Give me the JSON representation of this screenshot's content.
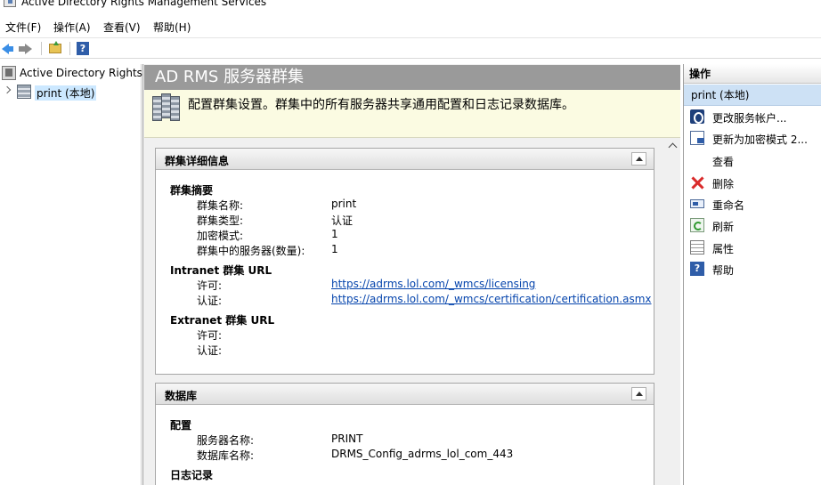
{
  "window": {
    "title": "Active Directory Rights Management Services"
  },
  "menu": [
    "文件(F)",
    "操作(A)",
    "查看(V)",
    "帮助(H)"
  ],
  "tree": {
    "root_label": "Active Directory Rights",
    "child_label": "print (本地)"
  },
  "center": {
    "title": "AD RMS 服务器群集",
    "banner_text": "配置群集设置。群集中的所有服务器共享通用配置和日志记录数据库。",
    "cluster_section": {
      "header": "群集详细信息",
      "summary": {
        "title": "群集摘要",
        "rows": [
          {
            "label": "群集名称:",
            "value": "print"
          },
          {
            "label": "群集类型:",
            "value": "认证"
          },
          {
            "label": "加密模式:",
            "value": "1"
          },
          {
            "label": "群集中的服务器(数量):",
            "value": "1"
          }
        ]
      },
      "intranet": {
        "title": "Intranet 群集 URL",
        "rows": [
          {
            "label": "许可:",
            "value": "https://adrms.lol.com/_wmcs/licensing"
          },
          {
            "label": "认证:",
            "value": "https://adrms.lol.com/_wmcs/certification/certification.asmx"
          }
        ]
      },
      "extranet": {
        "title": "Extranet 群集 URL",
        "rows": [
          {
            "label": "许可:",
            "value": ""
          },
          {
            "label": "认证:",
            "value": ""
          }
        ]
      }
    },
    "database_section": {
      "header": "数据库",
      "config": {
        "title": "配置",
        "rows": [
          {
            "label": "服务器名称:",
            "value": "PRINT"
          },
          {
            "label": "数据库名称:",
            "value": "DRMS_Config_adrms_lol_com_443"
          }
        ]
      },
      "logging": {
        "title": "日志记录"
      }
    }
  },
  "actions": {
    "header": "操作",
    "subheader": "print (本地)",
    "items": [
      {
        "label": "更改服务帐户...",
        "icon": "account-icon"
      },
      {
        "label": "更新为加密模式 2...",
        "icon": "encrypt-icon"
      },
      {
        "label": "查看",
        "icon": ""
      },
      {
        "label": "删除",
        "icon": "delete-icon"
      },
      {
        "label": "重命名",
        "icon": "rename-icon"
      },
      {
        "label": "刷新",
        "icon": "refresh-icon"
      },
      {
        "label": "属性",
        "icon": "properties-icon"
      },
      {
        "label": "帮助",
        "icon": "help-icon"
      }
    ]
  }
}
